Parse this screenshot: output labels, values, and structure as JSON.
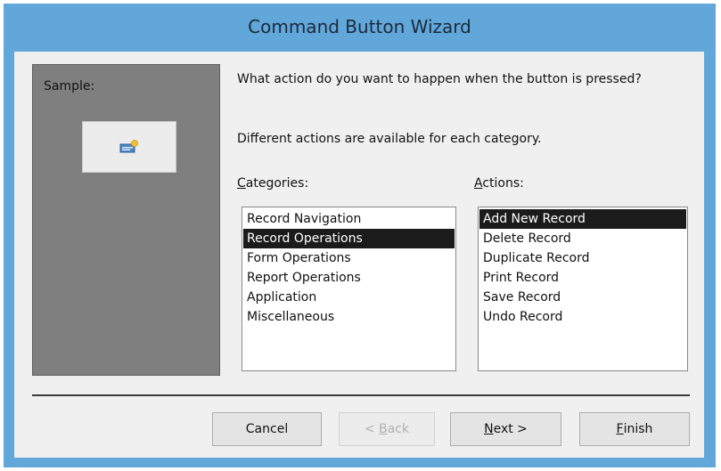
{
  "window": {
    "title": "Command Button Wizard",
    "accent_color": "#62a7da",
    "client_color": "#f0f0f0"
  },
  "sample": {
    "label": "Sample:",
    "preview_icon": "new-record-icon"
  },
  "instructions": {
    "question": "What action do you want to happen when the button is pressed?",
    "info": "Different actions are available for each category."
  },
  "categories": {
    "label_mnemonic": "C",
    "label_rest": "ategories:",
    "items": [
      "Record Navigation",
      "Record Operations",
      "Form Operations",
      "Report Operations",
      "Application",
      "Miscellaneous"
    ],
    "selected_index": 1
  },
  "actions": {
    "label_mnemonic": "A",
    "label_rest": "ctions:",
    "items": [
      "Add New Record",
      "Delete Record",
      "Duplicate Record",
      "Print Record",
      "Save Record",
      "Undo Record"
    ],
    "selected_index": 0
  },
  "buttons": {
    "cancel": "Cancel",
    "back_pre": "< ",
    "back_mnemonic": "B",
    "back_rest": "ack",
    "next_mnemonic": "N",
    "next_rest": "ext >",
    "finish_mnemonic": "F",
    "finish_rest": "inish"
  }
}
